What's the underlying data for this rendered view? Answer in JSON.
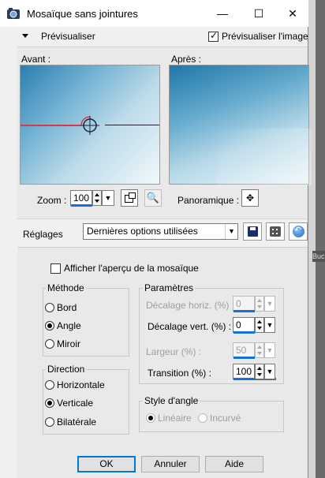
{
  "window": {
    "title": "Mosaïque sans jointures",
    "minimize_glyph": "—",
    "maximize_glyph": "☐",
    "close_glyph": "✕"
  },
  "preview": {
    "toggle_label": "Prévisualiser",
    "checkbox_label": "Prévisualiser l'image",
    "checkbox_checked": true,
    "before_label": "Avant :",
    "after_label": "Après :",
    "zoom_label": "Zoom :",
    "zoom_value": "100",
    "pan_label": "Panoramique :"
  },
  "presets": {
    "label": "Réglages",
    "selected": "Dernières options utilisées"
  },
  "settings": {
    "show_mosaic_preview_label": "Afficher l'aperçu de la mosaïque",
    "method": {
      "title": "Méthode",
      "options": [
        {
          "label": "Bord",
          "selected": false
        },
        {
          "label": "Angle",
          "selected": true
        },
        {
          "label": "Miroir",
          "selected": false
        }
      ]
    },
    "direction": {
      "title": "Direction",
      "options": [
        {
          "label": "Horizontale",
          "selected": false
        },
        {
          "label": "Verticale",
          "selected": true
        },
        {
          "label": "Bilatérale",
          "selected": false
        }
      ]
    },
    "parameters": {
      "title": "Paramètres",
      "horizontal_offset": {
        "label": "Décalage horiz. (%) :",
        "value": "0",
        "enabled": false
      },
      "vertical_offset": {
        "label": "Décalage vert. (%) :",
        "value": "0",
        "enabled": true
      },
      "width": {
        "label": "Largeur (%) :",
        "value": "50",
        "enabled": false
      },
      "transition": {
        "label": "Transition (%) :",
        "value": "100",
        "enabled": true
      }
    },
    "angle_style": {
      "title": "Style d'angle",
      "options": [
        {
          "label": "Linéaire",
          "selected": true
        },
        {
          "label": "Incurvé",
          "selected": false
        }
      ]
    }
  },
  "buttons": {
    "ok": "OK",
    "cancel": "Annuler",
    "help": "Aide"
  },
  "colors": {
    "accent": "#1a6fd6",
    "preview_blue": "#2a7fb0",
    "crosshair_red": "#d9374b"
  }
}
